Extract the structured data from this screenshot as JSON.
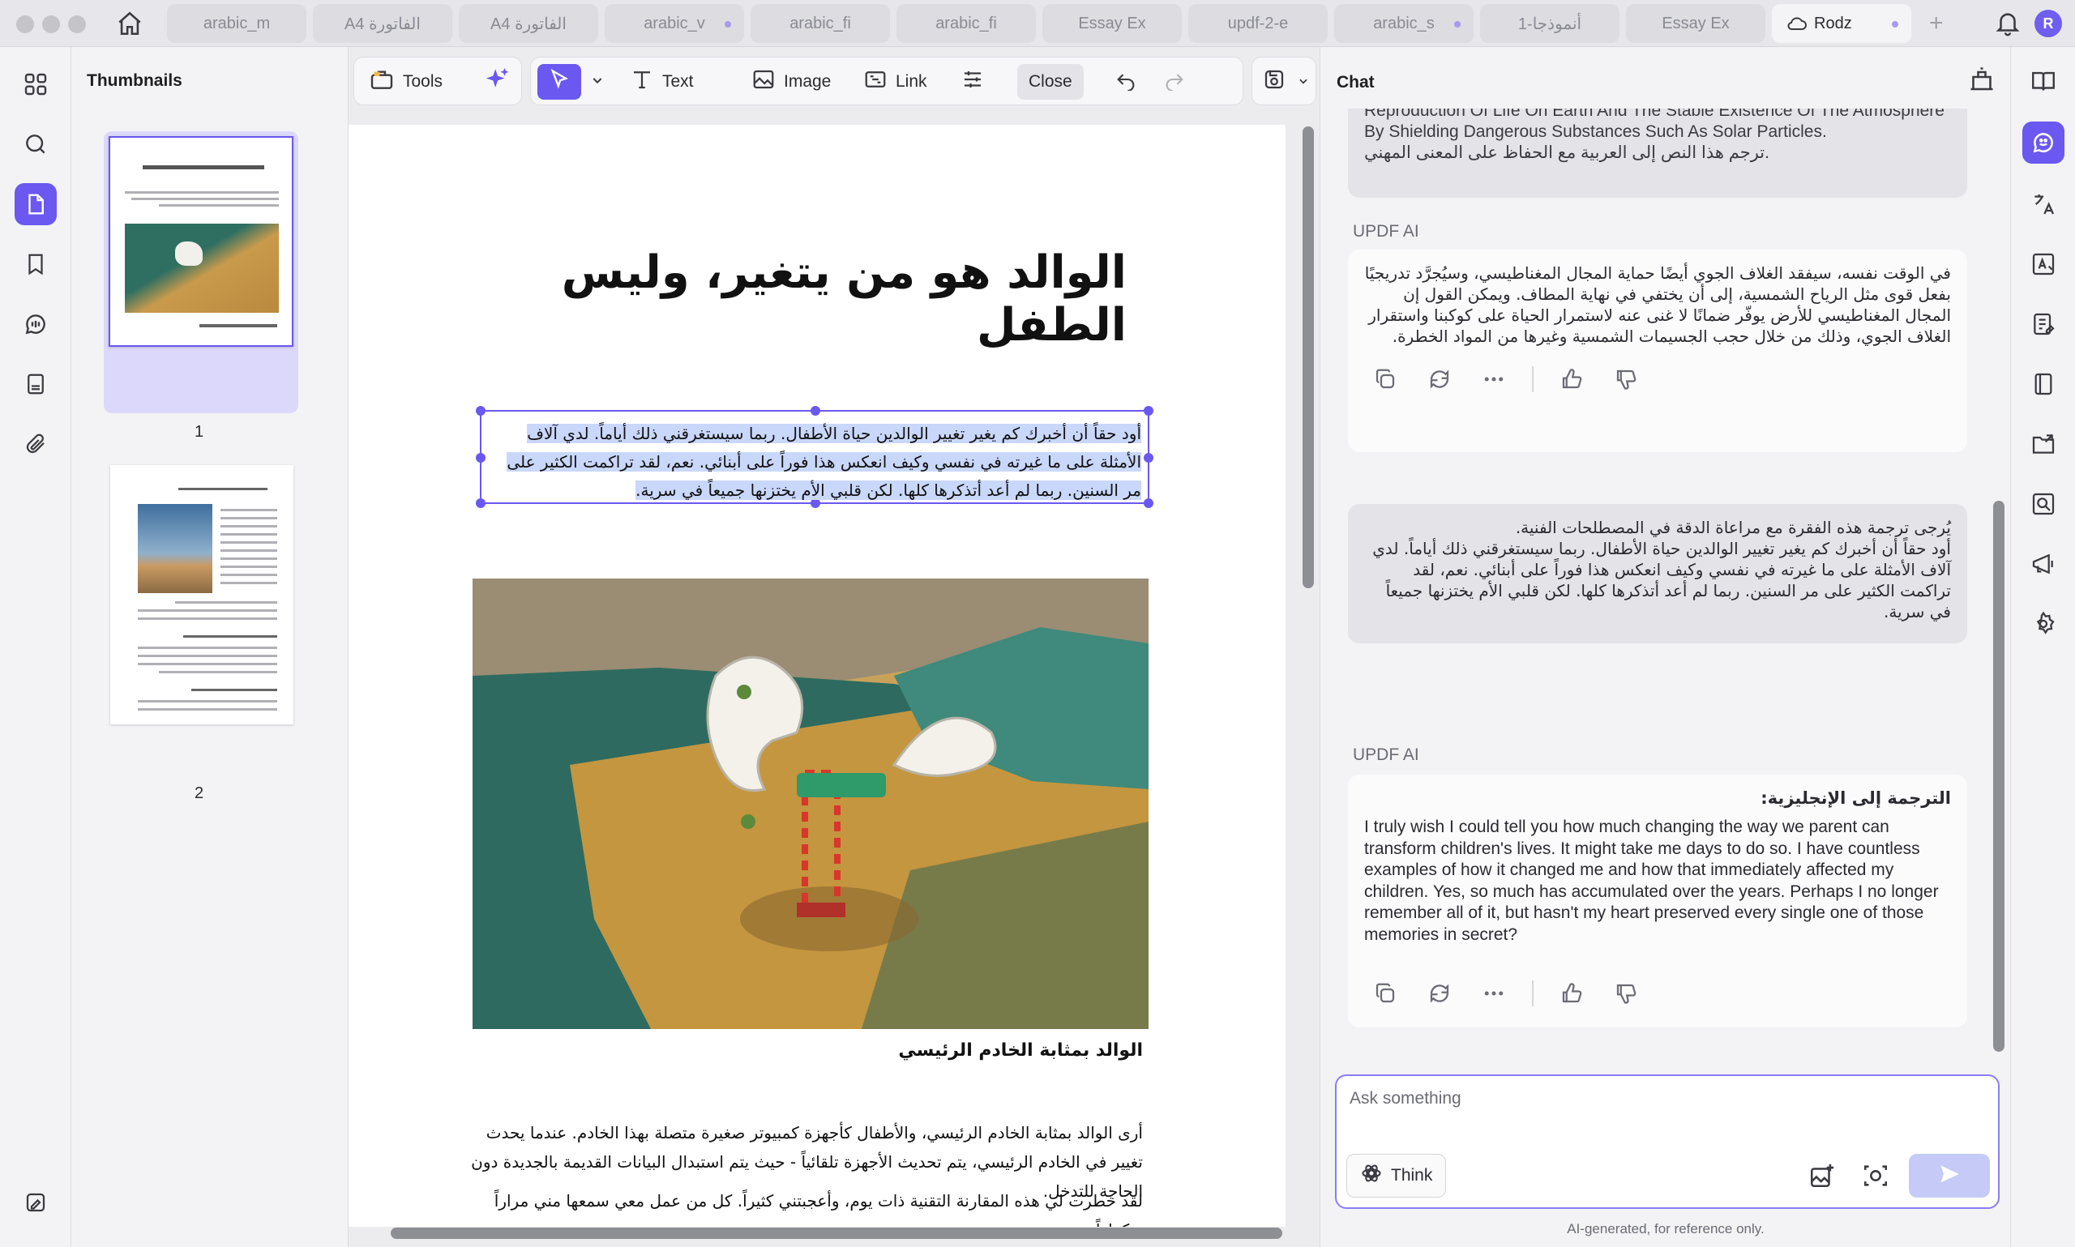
{
  "tabs": [
    {
      "label": "arabic_m",
      "dot": false
    },
    {
      "label": "A4 الفاتورة",
      "dot": false
    },
    {
      "label": "A4 الفاتورة",
      "dot": false
    },
    {
      "label": "arabic_v",
      "dot": true
    },
    {
      "label": "arabic_fi",
      "dot": false
    },
    {
      "label": "arabic_fi",
      "dot": false
    },
    {
      "label": "Essay Ex",
      "dot": false
    },
    {
      "label": "updf-2-e",
      "dot": false
    },
    {
      "label": "arabic_s",
      "dot": true
    },
    {
      "label": "1-أنموذجا",
      "dot": false
    },
    {
      "label": "Essay Ex",
      "dot": false
    },
    {
      "label": "Rodz",
      "dot": true
    }
  ],
  "user": {
    "avatar_initial": "R"
  },
  "thumbnails": {
    "title": "Thumbnails",
    "pages": [
      {
        "number": "1"
      },
      {
        "number": "2"
      }
    ]
  },
  "toolbar": {
    "tools_label": "Tools",
    "text_label": "Text",
    "image_label": "Image",
    "link_label": "Link",
    "close_label": "Close"
  },
  "document": {
    "title": "الوالد هو من يتغير، وليس الطفل",
    "selected_paragraph": "أود حقاً أن أخبرك كم يغير تغيير الوالدين حياة الأطفال. ربما سيستغرقني ذلك أياماً. لدي آلاف الأمثلة على ما غيرته في نفسي وكيف انعكس هذا فوراً على أبنائي. نعم، لقد تراكمت الكثير على مر السنين. ربما لم أعد أتذكرها كلها. لكن قلبي الأم يختزنها جميعاً في سرية.",
    "subheading": "الوالد بمثابة الخادم الرئيسي",
    "paragraph2": "أرى الوالد بمثابة الخادم الرئيسي، والأطفال كأجهزة كمبيوتر صغيرة متصلة بهذا الخادم. عندما يحدث تغيير في الخادم الرئيسي، يتم تحديث الأجهزة تلقائياً - حيث يتم استبدال البيانات القديمة بالجديدة دون الحاجة للتدخل.",
    "paragraph3": "لقد خطرت لي هذه المقارنة التقنية ذات يوم، وأعجبتني كثيراً. كل من عمل معي سمعها مني مراراً وتكراراً."
  },
  "chat": {
    "title": "Chat",
    "messages": [
      {
        "role": "user",
        "text": "Reproduction Of Life On Earth And The Stable Existence Of The Atmosphere By Shielding Dangerous Substances Such As Solar Particles.\nترجم هذا النص إلى العربية مع الحفاظ على المعنى المهني."
      },
      {
        "role": "ai",
        "label": "UPDF AI",
        "text": "في الوقت نفسه، سيفقد الغلاف الجوي أيضًا حماية المجال المغناطيسي، وسيُجرَّد تدريجيًا بفعل قوى مثل الرياح الشمسية، إلى أن يختفي في نهاية المطاف. ويمكن القول إن المجال المغناطيسي للأرض يوفّر ضمانًا لا غنى عنه لاستمرار الحياة على كوكبنا واستقرار الغلاف الجوي، وذلك من خلال حجب الجسيمات الشمسية وغيرها من المواد الخطرة."
      },
      {
        "role": "user",
        "text": "يُرجى ترجمة هذه الفقرة مع مراعاة الدقة في المصطلحات الفنية.\nأود حقاً أن أخبرك كم يغير تغيير الوالدين حياة الأطفال. ربما سيستغرقني ذلك أياماً. لدي آلاف الأمثلة على ما غيرته في نفسي وكيف انعكس هذا فوراً على أبنائي. نعم، لقد تراكمت الكثير على مر السنين. ربما لم أعد أتذكرها كلها. لكن قلبي الأم يختزنها جميعاً في سرية."
      },
      {
        "role": "ai",
        "label": "UPDF AI",
        "heading": "الترجمة إلى الإنجليزية:",
        "text": "I truly wish I could tell you how much changing the way we parent can transform children's lives. It might take me days to do so. I have countless examples of how it changed me and how that immediately affected my children. Yes, so much has accumulated over the years. Perhaps I no longer remember all of it, but hasn't my heart preserved every single one of those memories in secret?"
      }
    ],
    "input_placeholder": "Ask something",
    "think_label": "Think",
    "disclaimer": "AI-generated, for reference only."
  },
  "colors": {
    "accent": "#6a58f0",
    "selection": "#c9d7fa",
    "tab_dot": "#a69bf0"
  }
}
